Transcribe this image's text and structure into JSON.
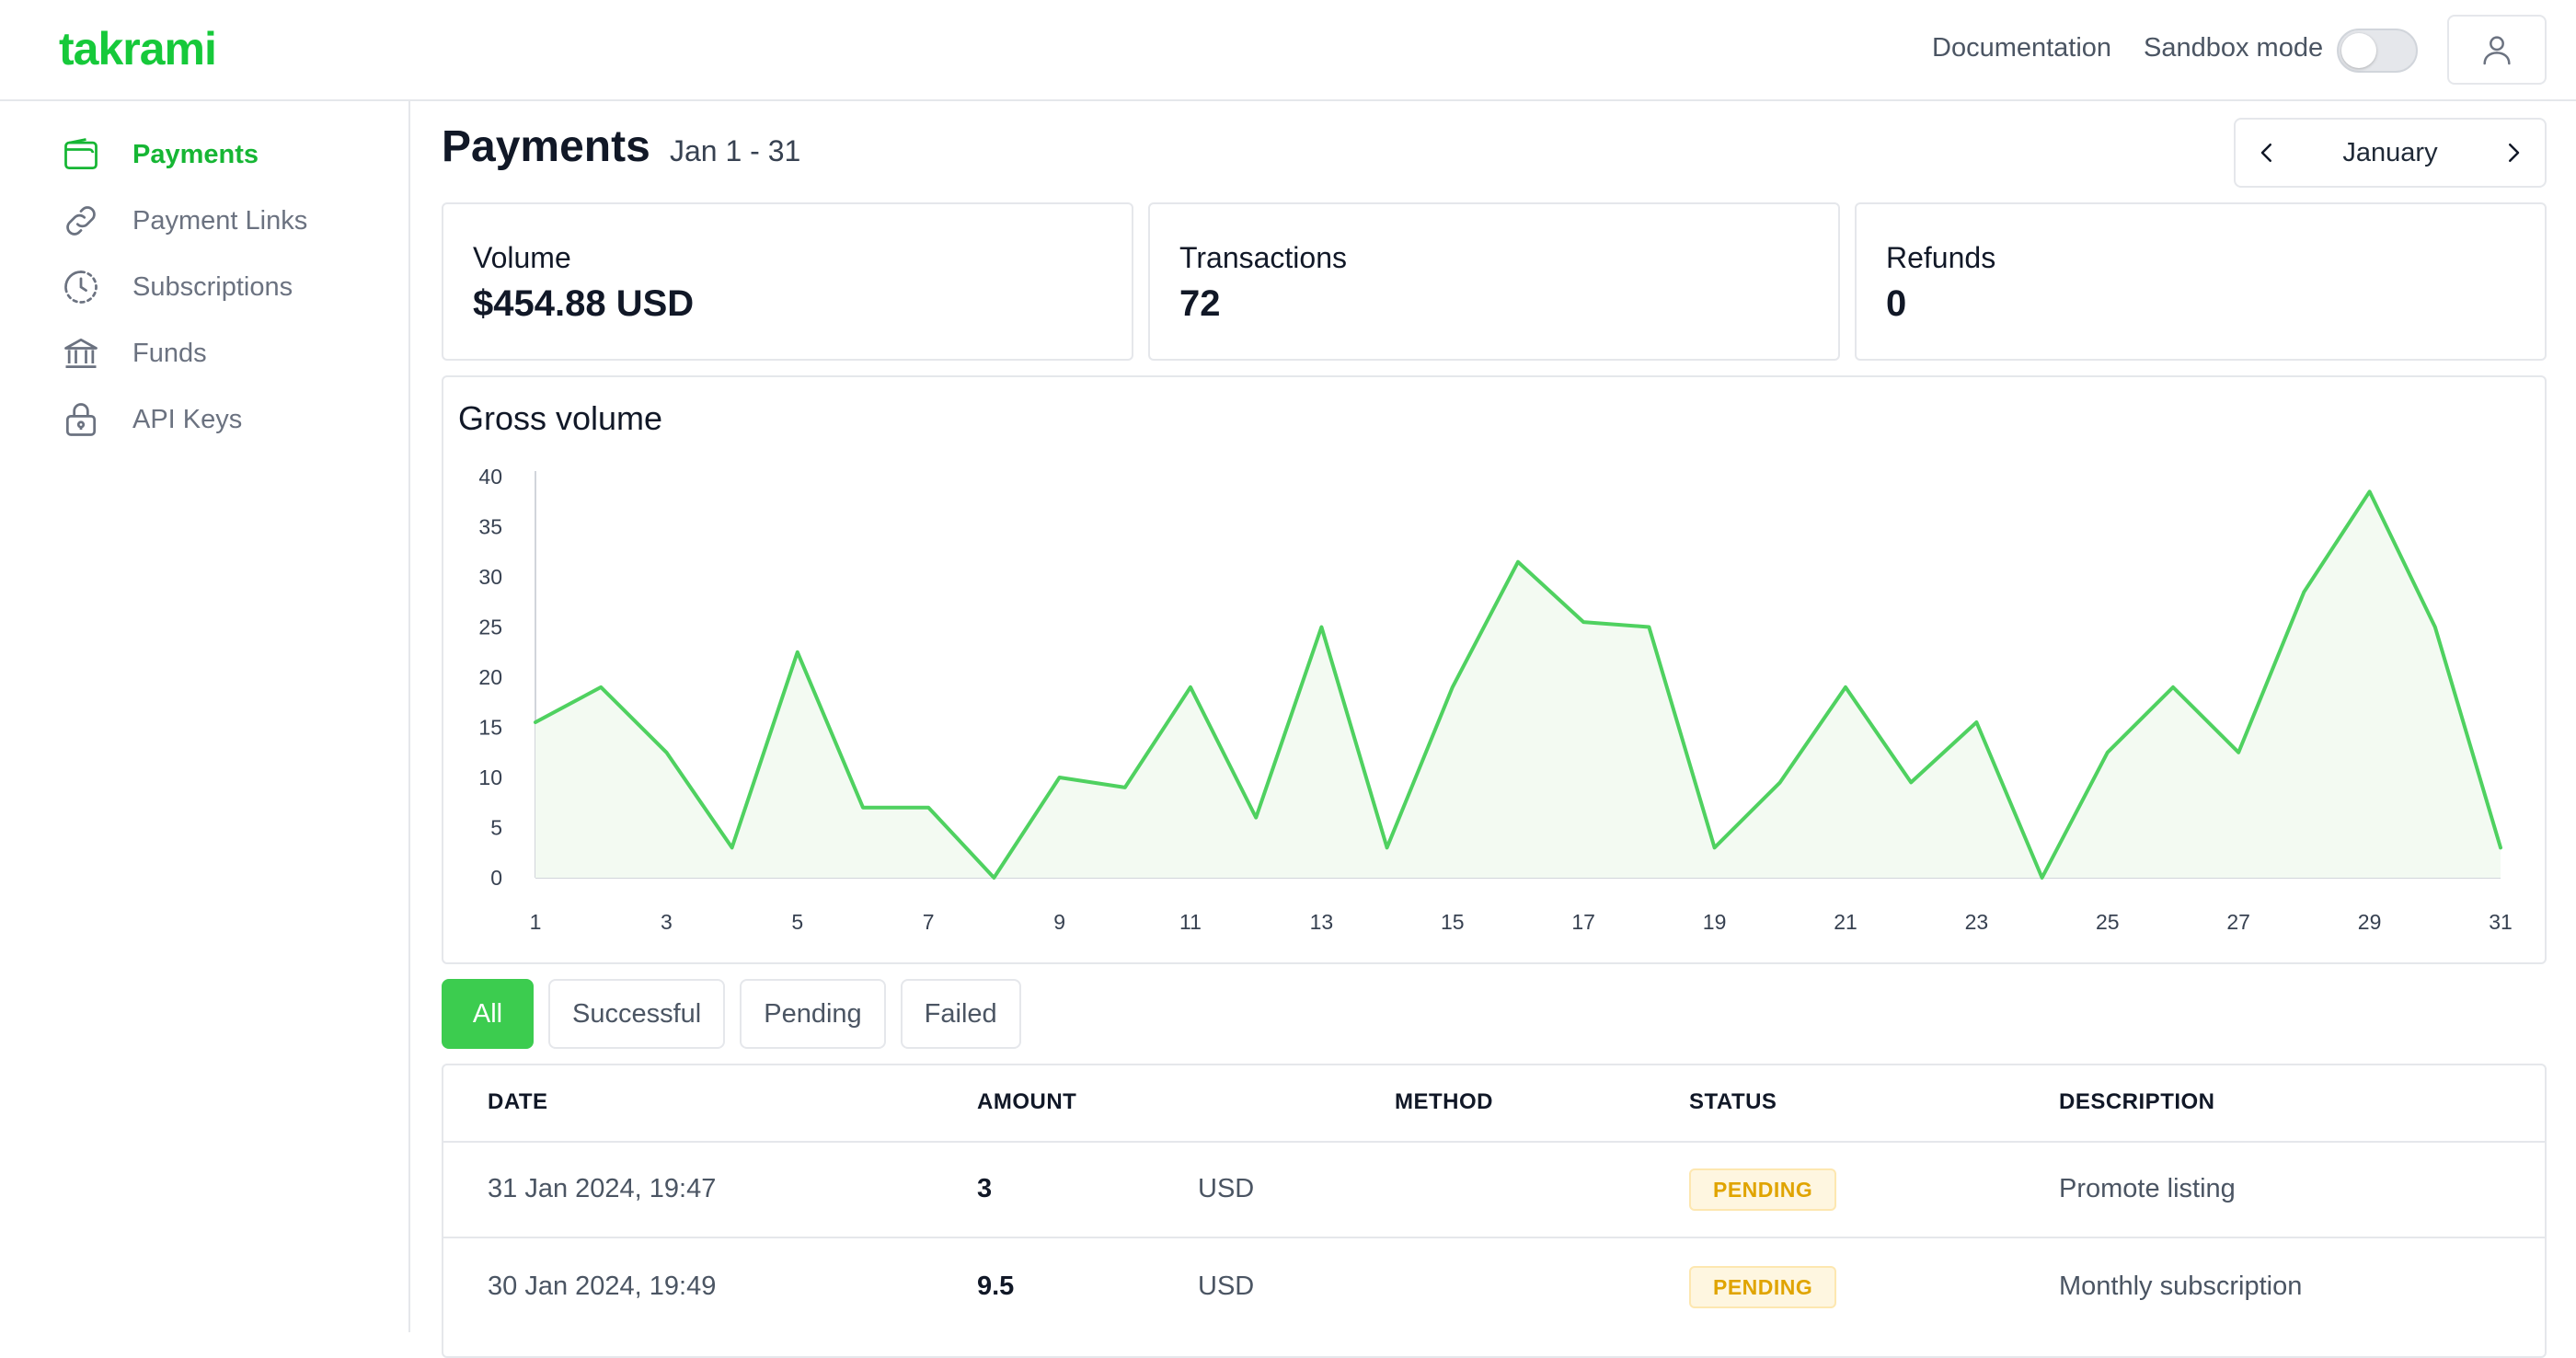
{
  "header": {
    "logo": "takrami",
    "documentation": "Documentation",
    "sandbox_label": "Sandbox mode",
    "sandbox_enabled": false
  },
  "sidebar": {
    "items": [
      {
        "label": "Payments",
        "icon": "wallet-icon",
        "active": true
      },
      {
        "label": "Payment Links",
        "icon": "link-icon",
        "active": false
      },
      {
        "label": "Subscriptions",
        "icon": "clock-icon",
        "active": false
      },
      {
        "label": "Funds",
        "icon": "bank-icon",
        "active": false
      },
      {
        "label": "API Keys",
        "icon": "lock-icon",
        "active": false
      }
    ]
  },
  "page": {
    "title": "Payments",
    "range": "Jan 1 - 31",
    "month": "January"
  },
  "stats": [
    {
      "label": "Volume",
      "value": "$454.88 USD"
    },
    {
      "label": "Transactions",
      "value": "72"
    },
    {
      "label": "Refunds",
      "value": "0"
    }
  ],
  "chart": {
    "title": "Gross volume"
  },
  "chart_data": {
    "type": "area",
    "title": "Gross volume",
    "xlabel": "",
    "ylabel": "",
    "x": [
      1,
      2,
      3,
      4,
      5,
      6,
      7,
      8,
      9,
      10,
      11,
      12,
      13,
      14,
      15,
      16,
      17,
      18,
      19,
      20,
      21,
      22,
      23,
      24,
      25,
      26,
      27,
      28,
      29,
      30,
      31
    ],
    "x_ticks": [
      1,
      3,
      5,
      7,
      9,
      11,
      13,
      15,
      17,
      19,
      21,
      23,
      25,
      27,
      29,
      31
    ],
    "y_ticks": [
      0,
      5,
      10,
      15,
      20,
      25,
      30,
      35,
      40
    ],
    "values": [
      15.5,
      19,
      12.5,
      3,
      22.5,
      7,
      7,
      0,
      10,
      9,
      19,
      6,
      25,
      3,
      19,
      31.5,
      25.5,
      25,
      3,
      9.5,
      19,
      9.5,
      15.5,
      0,
      12.5,
      19,
      12.5,
      28.5,
      38.5,
      25,
      3
    ],
    "ylim": [
      0,
      40
    ],
    "xlim": [
      1,
      31
    ],
    "grid": false,
    "line_color": "#4fd160",
    "fill_color": "#f3faf2"
  },
  "filters": [
    {
      "label": "All",
      "active": true
    },
    {
      "label": "Successful",
      "active": false
    },
    {
      "label": "Pending",
      "active": false
    },
    {
      "label": "Failed",
      "active": false
    }
  ],
  "table": {
    "columns": [
      "DATE",
      "AMOUNT",
      "METHOD",
      "STATUS",
      "DESCRIPTION"
    ],
    "rows": [
      {
        "date": "31 Jan 2024, 19:47",
        "amount": "3",
        "currency": "USD",
        "method": "",
        "status": "PENDING",
        "description": "Promote listing"
      },
      {
        "date": "30 Jan 2024, 19:49",
        "amount": "9.5",
        "currency": "USD",
        "method": "",
        "status": "PENDING",
        "description": "Monthly subscription"
      }
    ]
  },
  "colors": {
    "brand": "#16c93a",
    "accent_button": "#3ccc4f",
    "pending_text": "#e0a400",
    "pending_bg": "#fef6e0"
  }
}
